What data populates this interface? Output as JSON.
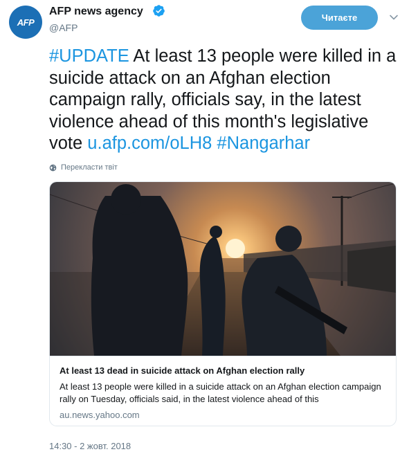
{
  "header": {
    "avatar_text": "AFP",
    "display_name": "AFP news agency",
    "handle": "@AFP",
    "verified_icon": "verified-badge-icon",
    "follow_label": "Читаєте",
    "menu_icon": "chevron-down-icon"
  },
  "tweet": {
    "hashtag_update": "#UPDATE",
    "text_body": " At least 13 people were killed in a suicide attack on an Afghan election campaign rally, officials say, in the latest violence ahead of this month's legislative vote ",
    "link": "u.afp.com/oLH8",
    "space": " ",
    "hashtag_place": "#Nangarhar",
    "translate_label": "Перекласти твіт",
    "translate_icon": "globe-icon"
  },
  "card": {
    "title": "At least 13 dead in suicide attack on Afghan election rally",
    "description": "At least 13 people were killed in a suicide attack on an Afghan election campaign rally on Tuesday, officials said, in the latest violence ahead of this",
    "domain": "au.news.yahoo.com"
  },
  "timestamp": "14:30 - 2 жовт. 2018",
  "colors": {
    "link": "#1b95e0",
    "follow_button": "#4ba3d8",
    "avatar": "#1c6fb5",
    "secondary_text": "#657786"
  }
}
